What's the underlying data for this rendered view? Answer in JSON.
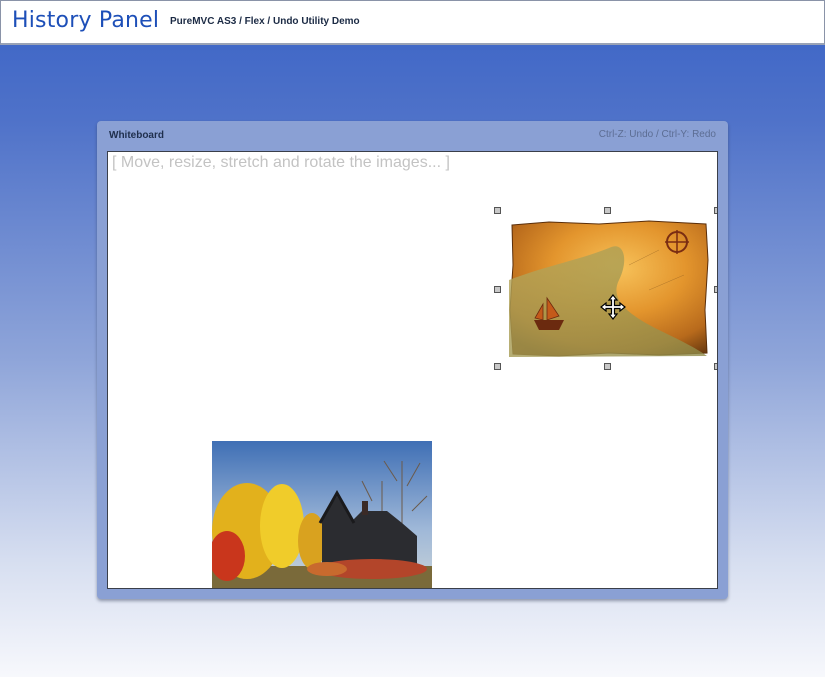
{
  "header": {
    "title": "History Panel",
    "subtitle": "PureMVC AS3 / Flex / Undo Utility Demo"
  },
  "panel": {
    "title": "Whiteboard",
    "shortcuts_hint": "Ctrl-Z: Undo / Ctrl-Y: Redo"
  },
  "whiteboard": {
    "instructions": "[ Move, resize, stretch and rotate the images... ]",
    "images": [
      {
        "name": "treasure-map",
        "selected": true
      },
      {
        "name": "autumn-house",
        "selected": false
      }
    ]
  },
  "colors": {
    "title_blue": "#1d4fb8",
    "background_top": "#3a63c6",
    "panel": "#8aa0d4"
  }
}
